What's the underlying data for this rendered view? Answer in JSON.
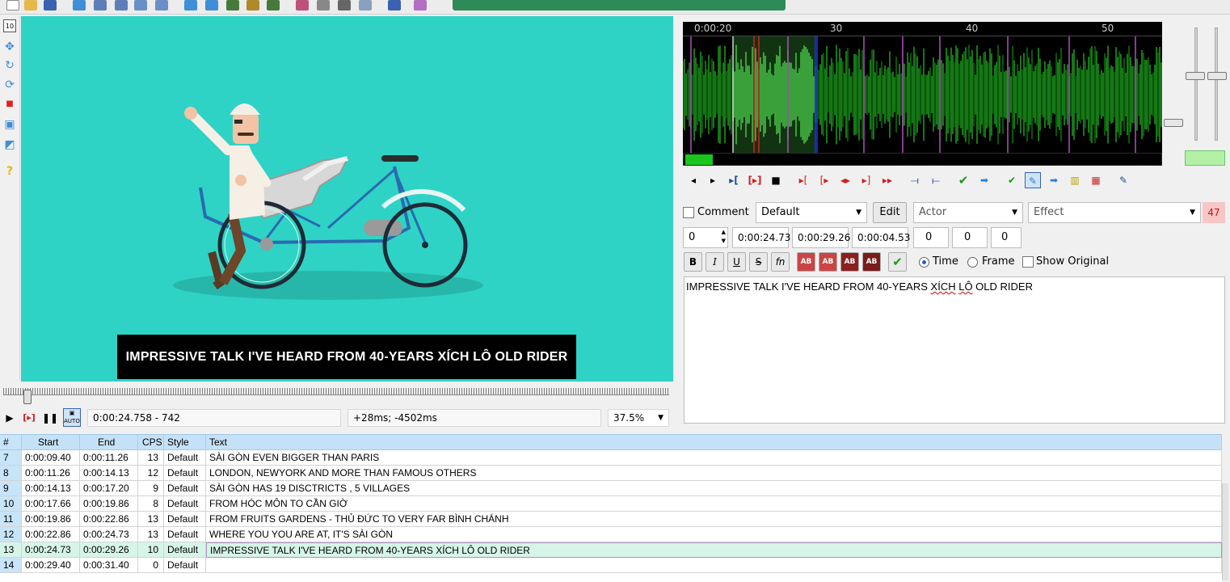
{
  "colors": {
    "video_bg": "#2ed3c5",
    "waveform": "#1faa1f",
    "grid_header": "#c4e1f7",
    "active_row": "#d6f5e8"
  },
  "video": {
    "subtitle": "IMPRESSIVE TALK I'VE HEARD FROM 40-YEARS XÍCH LÔ OLD RIDER",
    "timecode": "0:00:24.758 - 742",
    "offset": "+28ms; -4502ms",
    "zoom": "37.5%",
    "seek_position": 0.03
  },
  "audio": {
    "ruler": [
      "0:00:20",
      "30",
      "40",
      "50"
    ],
    "icons": [
      "prev-line",
      "next-line",
      "play-selection-begin",
      "play-selection",
      "stop",
      "play-before",
      "play-after",
      "play-start",
      "play-end",
      "play-to-end",
      "join-prev",
      "join-next",
      "commit",
      "next",
      "auto-commit",
      "auto-next",
      "auto-scroll",
      "spectrum",
      "karaoke",
      "lead-in-out"
    ]
  },
  "edit": {
    "comment_label": "Comment",
    "style": "Default",
    "edit_label": "Edit",
    "actor_placeholder": "Actor",
    "effect_placeholder": "Effect",
    "char_count": "47",
    "layer": "0",
    "start": "0:00:24.73",
    "end": "0:00:29.26",
    "duration": "0:00:04.53",
    "margin_l": "0",
    "margin_r": "0",
    "margin_v": "0",
    "format_buttons": [
      "B",
      "I",
      "U",
      "S",
      "fn"
    ],
    "color_buttons": [
      "AB",
      "AB",
      "AB",
      "AB"
    ],
    "time_label": "Time",
    "frame_label": "Frame",
    "show_original_label": "Show Original",
    "text_before": "IMPRESSIVE TALK I'VE HEARD FROM 40-YEARS ",
    "text_sq1": "XÍCH",
    "text_space": " ",
    "text_sq2": "LÔ",
    "text_after": " OLD RIDER"
  },
  "grid": {
    "headers": [
      "#",
      "Start",
      "End",
      "CPS",
      "Style",
      "Text"
    ],
    "rows": [
      {
        "num": "7",
        "start": "0:00:09.40",
        "end": "0:00:11.26",
        "cps": "13",
        "style": "Default",
        "text": "SÀI GÒN EVEN BIGGER THAN PARIS"
      },
      {
        "num": "8",
        "start": "0:00:11.26",
        "end": "0:00:14.13",
        "cps": "12",
        "style": "Default",
        "text": "LONDON, NEWYORK AND MORE THAN FAMOUS OTHERS"
      },
      {
        "num": "9",
        "start": "0:00:14.13",
        "end": "0:00:17.20",
        "cps": "9",
        "style": "Default",
        "text": "SÀI GÒN HAS 19 DISCTRICTS , 5 VILLAGES"
      },
      {
        "num": "10",
        "start": "0:00:17.66",
        "end": "0:00:19.86",
        "cps": "8",
        "style": "Default",
        "text": "FROM HÓC MÔN TO CẦN GIỜ"
      },
      {
        "num": "11",
        "start": "0:00:19.86",
        "end": "0:00:22.86",
        "cps": "13",
        "style": "Default",
        "text": "FROM FRUITS GARDENS - THỦ ĐỨC TO VERY FAR BÌNH CHÁNH"
      },
      {
        "num": "12",
        "start": "0:00:22.86",
        "end": "0:00:24.73",
        "cps": "13",
        "style": "Default",
        "text": "WHERE YOU YOU ARE AT, IT'S SÀI GÒN"
      },
      {
        "num": "13",
        "start": "0:00:24.73",
        "end": "0:00:29.26",
        "cps": "10",
        "style": "Default",
        "text": "IMPRESSIVE TALK I'VE HEARD FROM 40-YEARS XÍCH LÔ OLD RIDER"
      },
      {
        "num": "14",
        "start": "0:00:29.40",
        "end": "0:00:31.40",
        "cps": "0",
        "style": "Default",
        "text": ""
      }
    ]
  }
}
